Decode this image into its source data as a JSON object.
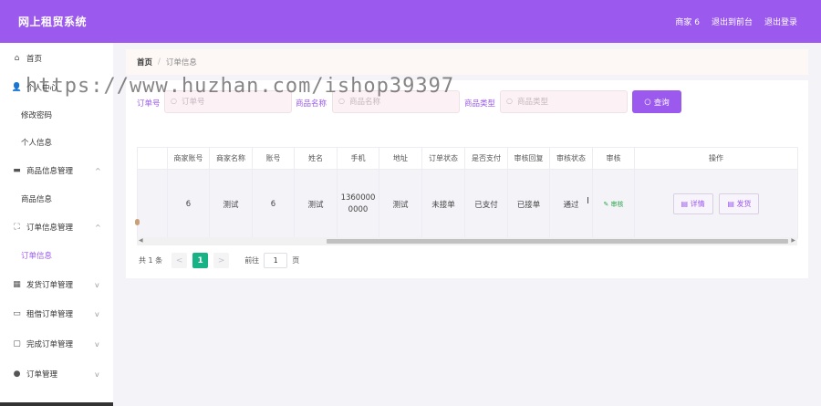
{
  "header": {
    "brand": "网上租贸系统",
    "links": [
      "商家 6",
      "退出到前台",
      "退出登录"
    ]
  },
  "sidebar": {
    "items": [
      {
        "label": "首页",
        "icon": "home-icon",
        "glyph": "⌂",
        "chevron": false,
        "sub": false,
        "active": false
      },
      {
        "label": "个人中心",
        "icon": "user-icon",
        "glyph": "👤",
        "chevron": false,
        "sub": false,
        "active": false
      },
      {
        "label": "修改密码",
        "icon": "",
        "glyph": "",
        "chevron": false,
        "sub": true,
        "active": false
      },
      {
        "label": "个人信息",
        "icon": "",
        "glyph": "",
        "chevron": false,
        "sub": true,
        "active": false
      },
      {
        "label": "商品信息管理",
        "icon": "chat-icon",
        "glyph": "▬",
        "chevron": true,
        "chevron_glyph": "^",
        "sub": false,
        "active": false
      },
      {
        "label": "商品信息",
        "icon": "",
        "glyph": "",
        "chevron": false,
        "sub": true,
        "active": false
      },
      {
        "label": "订单信息管理",
        "icon": "expand-icon",
        "glyph": "⛶",
        "chevron": true,
        "chevron_glyph": "^",
        "sub": false,
        "active": false
      },
      {
        "label": "订单信息",
        "icon": "",
        "glyph": "",
        "chevron": false,
        "sub": true,
        "active": true
      },
      {
        "label": "发货订单管理",
        "icon": "edit-icon",
        "glyph": "▦",
        "chevron": true,
        "chevron_glyph": "v",
        "sub": false,
        "active": false
      },
      {
        "label": "租借订单管理",
        "icon": "card-icon",
        "glyph": "▭",
        "chevron": true,
        "chevron_glyph": "v",
        "sub": false,
        "active": false
      },
      {
        "label": "完成订单管理",
        "icon": "message-icon",
        "glyph": "▢",
        "chevron": true,
        "chevron_glyph": "v",
        "sub": false,
        "active": false
      },
      {
        "label": "订单管理",
        "icon": "location-icon",
        "glyph": "●",
        "chevron": true,
        "chevron_glyph": "v",
        "sub": false,
        "active": false
      }
    ]
  },
  "breadcrumb": {
    "home": "首页",
    "separator": "/",
    "current": "订单信息"
  },
  "search": {
    "order_no_label": "订单号",
    "order_no_placeholder": "订单号",
    "product_name_label": "商品名称",
    "product_name_placeholder": "商品名称",
    "product_type_label": "商品类型",
    "product_type_placeholder": "商品类型",
    "query_button": "查询"
  },
  "watermark": "https://www.huzhan.com/ishop39397",
  "table": {
    "columns": [
      "",
      "商家账号",
      "商家名称",
      "账号",
      "姓名",
      "手机",
      "地址",
      "订单状态",
      "是否支付",
      "审核回复",
      "审核状态",
      "审核",
      "操作"
    ],
    "rows": [
      {
        "merchant_account": "6",
        "merchant_name": "测试",
        "account": "6",
        "name": "测试",
        "phone_line1": "1360000",
        "phone_line2": "0000",
        "address": "测试",
        "order_status": "未接单",
        "paid": "已支付",
        "audit_reply": "已接单",
        "audit_status": "通过",
        "audit_action": "审核",
        "detail_button": "详情",
        "ship_button": "发货"
      }
    ]
  },
  "pagination": {
    "total": "共 1 条",
    "prev": "<",
    "current_page": "1",
    "next": ">",
    "goto_label": "前往",
    "goto_value": "1",
    "page_suffix": "页"
  }
}
